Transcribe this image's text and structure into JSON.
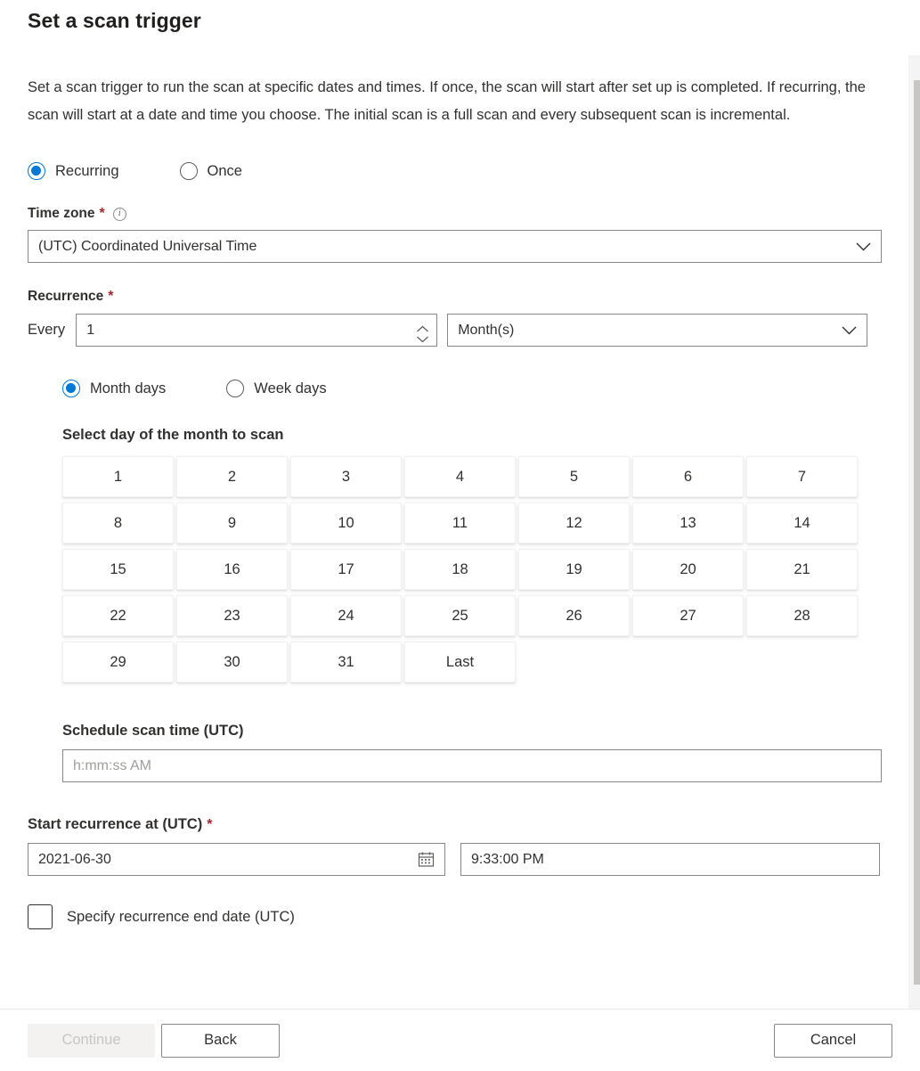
{
  "header": {
    "title": "Set a scan trigger",
    "description": "Set a scan trigger to run the scan at specific dates and times. If once, the scan will start after set up is completed. If recurring, the scan will start at a date and time you choose. The initial scan is a full scan and every subsequent scan is incremental."
  },
  "trigger_mode": {
    "options": [
      {
        "label": "Recurring",
        "selected": true
      },
      {
        "label": "Once",
        "selected": false
      }
    ]
  },
  "timezone": {
    "label": "Time zone",
    "required_mark": "*",
    "info_icon": "info-icon",
    "value": "(UTC) Coordinated Universal Time",
    "chevron_icon": "chevron-down-icon"
  },
  "recurrence": {
    "label": "Recurrence",
    "required_mark": "*",
    "every_label": "Every",
    "interval_value": "1",
    "interval_up_icon": "chevron-up-icon",
    "interval_down_icon": "chevron-down-icon",
    "unit_value": "Month(s)",
    "unit_chevron_icon": "chevron-down-icon",
    "day_mode": {
      "options": [
        {
          "label": "Month days",
          "selected": true
        },
        {
          "label": "Week days",
          "selected": false
        }
      ]
    },
    "grid_caption": "Select day of the month to scan",
    "days": [
      "1",
      "2",
      "3",
      "4",
      "5",
      "6",
      "7",
      "8",
      "9",
      "10",
      "11",
      "12",
      "13",
      "14",
      "15",
      "16",
      "17",
      "18",
      "19",
      "20",
      "21",
      "22",
      "23",
      "24",
      "25",
      "26",
      "27",
      "28",
      "29",
      "30",
      "31",
      "Last"
    ],
    "schedule_time": {
      "label": "Schedule scan time (UTC)",
      "value": "",
      "placeholder": "h:mm:ss AM"
    }
  },
  "start_recurrence": {
    "label": "Start recurrence at (UTC)",
    "required_mark": "*",
    "date_value": "2021-06-30",
    "calendar_icon": "calendar-icon",
    "time_value": "9:33:00 PM"
  },
  "end_date": {
    "label": "Specify recurrence end date (UTC)",
    "checked": false
  },
  "footer": {
    "continue_label": "Continue",
    "continue_disabled": true,
    "back_label": "Back",
    "cancel_label": "Cancel"
  },
  "colors": {
    "accent": "#0078d4",
    "required": "#a4262c",
    "text": "#323130",
    "border": "#8a8886"
  }
}
